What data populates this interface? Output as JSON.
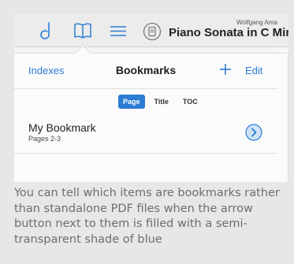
{
  "toolbar": {
    "icons": [
      "music-note-icon",
      "book-icon",
      "menu-icon",
      "document-icon"
    ],
    "composer": "Wolfgang Ama",
    "score_title": "Piano Sonata in C Minor,"
  },
  "popover": {
    "left_link": "Indexes",
    "title": "Bookmarks",
    "add_icon": "plus-icon",
    "right_link": "Edit",
    "segments": [
      "Page",
      "Title",
      "TOC"
    ],
    "active_segment": "Page",
    "bookmarks": [
      {
        "name": "My Bookmark",
        "pages": "Pages 2-3",
        "arrow_icon": "chevron-right-circle-icon"
      }
    ]
  },
  "caption": "You can tell which items are bookmarks rather than standalone PDF files when the arrow button next to them is filled with a semi-transparent shade of blue",
  "colors": {
    "accent": "#2b7cd3",
    "arrow_fill": "#cfe3f8"
  }
}
